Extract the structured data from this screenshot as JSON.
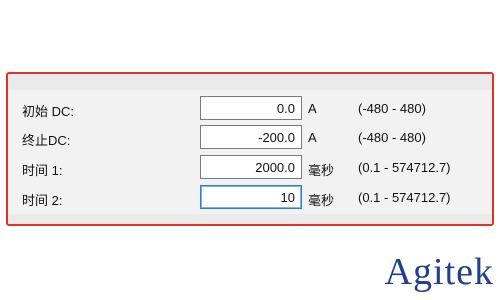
{
  "form": {
    "rows": [
      {
        "label": "初始 DC:",
        "value": "0.0",
        "unit": "A",
        "range": "(-480 - 480)"
      },
      {
        "label": "终止DC:",
        "value": "-200.0",
        "unit": "A",
        "range": "(-480 - 480)"
      },
      {
        "label": "时间 1:",
        "value": "2000.0",
        "unit": "毫秒",
        "range": "(0.1 - 574712.7)"
      },
      {
        "label": "时间 2:",
        "value": "10",
        "unit": "毫秒",
        "range": "(0.1 - 574712.7)"
      }
    ]
  },
  "logo": {
    "text": "Agitek"
  },
  "colors": {
    "highlight_border": "#e0312b",
    "focus_border": "#2f7bd6",
    "logo": "#1f3f92"
  }
}
